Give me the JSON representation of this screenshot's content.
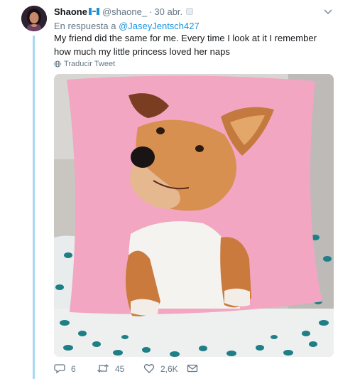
{
  "tweet": {
    "display_name": "Shaone",
    "handle": "@shaone_",
    "separator": "·",
    "date": "30 abr.",
    "reply_prefix": "En respuesta a",
    "reply_mention": "@JaseyJentsch427",
    "text": "My friend did the same for me. Every time I look at it I remember how much my little princess loved her naps",
    "translate_label": "Traducir Tweet",
    "image_description_icon": "dog-pillow-photo"
  },
  "actions": {
    "reply_count": "6",
    "retweet_count": "45",
    "like_count": "2,6K"
  },
  "colors": {
    "link": "#1b95e0",
    "muted": "#657786",
    "thread_line": "#a8d7ef",
    "pillow_pink": "#f2a6c2"
  }
}
